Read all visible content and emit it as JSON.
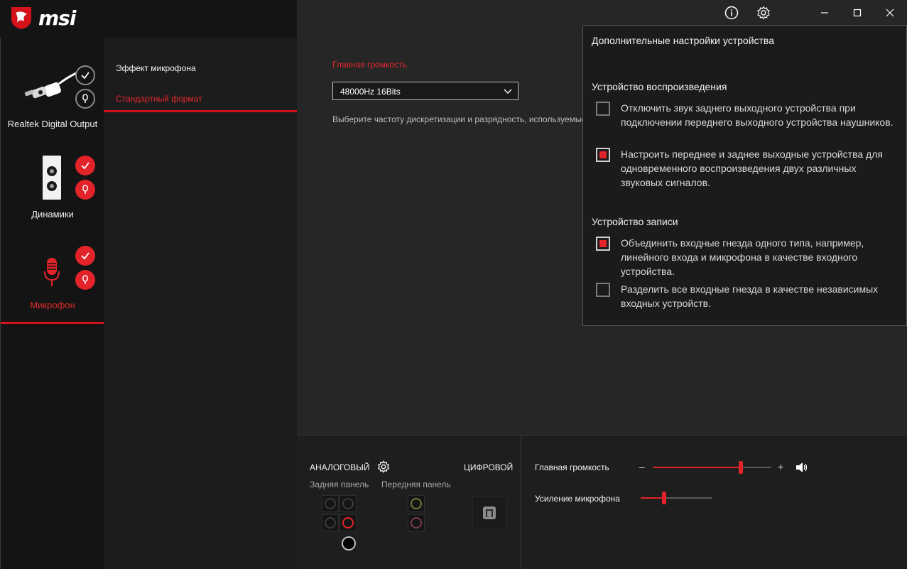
{
  "brand": {
    "name": "msi"
  },
  "window_controls": {
    "info_icon": "info-icon",
    "settings_icon": "gear-icon",
    "minimize": "minimize-icon",
    "maximize": "maximize-icon",
    "close": "close-icon"
  },
  "devices": [
    {
      "label": "Realtek Digital Output",
      "icon": "digital-cable-icon",
      "active": false
    },
    {
      "label": "Динамики",
      "icon": "speaker-icon",
      "active": false
    },
    {
      "label": "Микрофон",
      "icon": "microphone-icon",
      "active": true
    }
  ],
  "submenu": [
    {
      "label": "Эффект микрофона",
      "active": false
    },
    {
      "label": "Стандартный формат",
      "active": true
    }
  ],
  "main": {
    "title": "Главная громкость",
    "format_value": "48000Hz 16Bits",
    "description": "Выберите частоту дискретизации и разрядность, используемые по умолчанию"
  },
  "popup": {
    "title": "Дополнительные настройки устройства",
    "playback_heading": "Устройство воспроизведения",
    "playback_options": [
      {
        "text": "Отключить звук заднего выходного устройства при подключении переднего выходного устройства наушников.",
        "checked": false
      },
      {
        "text": "Настроить переднее и заднее выходные устройства для одновременного воспроизведения двух различных звуковых сигналов.",
        "checked": true
      }
    ],
    "record_heading": "Устройство записи",
    "record_options": [
      {
        "text": "Объединить входные гнезда одного типа, например, линейного входа и микрофона в качестве входного устройства.",
        "checked": true
      },
      {
        "text": "Разделить все входные гнезда в качестве независимых входных устройств.",
        "checked": false
      }
    ]
  },
  "bottom": {
    "analog_label": "АНАЛОГОВЫЙ",
    "digital_label": "ЦИФРОВОЙ",
    "rear_panel": "Задняя панель",
    "front_panel": "Передняя панель",
    "master_volume_label": "Главная громкость",
    "master_volume_level": 0.74,
    "minus": "–",
    "plus": "+",
    "mic_boost_label": "Усиление микрофона",
    "mic_boost_level": 0.33
  },
  "colors": {
    "accent": "#e3232a",
    "background": "#232323",
    "sidebar": "#141414"
  }
}
